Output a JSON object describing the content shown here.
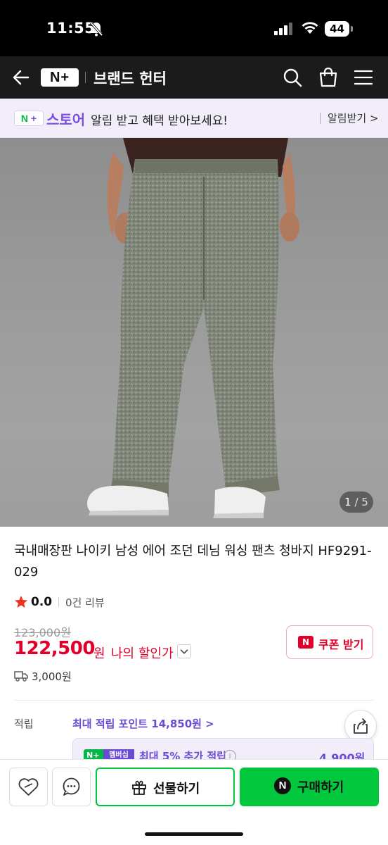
{
  "status_bar": {
    "time": "11:55",
    "battery": "44"
  },
  "header": {
    "logo": "N+",
    "title": "브랜드 헌터"
  },
  "banner": {
    "badge_n": "N",
    "badge_plus": "+",
    "store_name": "스토어",
    "message": "알림 받고 혜택 받아보세요!",
    "alert_button": "알림받기 >"
  },
  "gallery": {
    "current": "1",
    "separator": " / ",
    "total": "5"
  },
  "product": {
    "title": "국내매장판 나이키 남성 에어 조던 데님 워싱 팬츠 청바지 HF9291-029",
    "rating": "0.0",
    "reviews": "0건 리뷰",
    "original_price": "123,000원",
    "sale_price": "122,500",
    "currency": "원",
    "my_discount": "나의 할인가",
    "coupon_icon": "N",
    "coupon": "쿠폰 받기",
    "shipping": "3,000원"
  },
  "points": {
    "label": "적립",
    "max": "최대 적립 포인트 14,850원 >",
    "member_badge": "N+",
    "member_badge_sub": "멤버십",
    "member_text": "최대 5% 추가 적립",
    "member_info": "i",
    "member_amount": "4,900원"
  },
  "bottom": {
    "gift": "선물하기",
    "buy_icon": "N",
    "buy": "구매하기"
  },
  "colors": {
    "accent_green": "#00c73c",
    "accent_purple": "#6a4bd6",
    "price_red": "#e0002a",
    "header_bg": "#1b1b1b"
  },
  "icons": [
    "bell-off-icon",
    "signal-icon",
    "wifi-icon",
    "battery-icon",
    "back-arrow-icon",
    "search-icon",
    "shopping-bag-icon",
    "menu-icon",
    "star-icon",
    "chevron-down-icon",
    "truck-icon",
    "share-icon",
    "heart-icon",
    "chat-icon",
    "gift-icon"
  ]
}
